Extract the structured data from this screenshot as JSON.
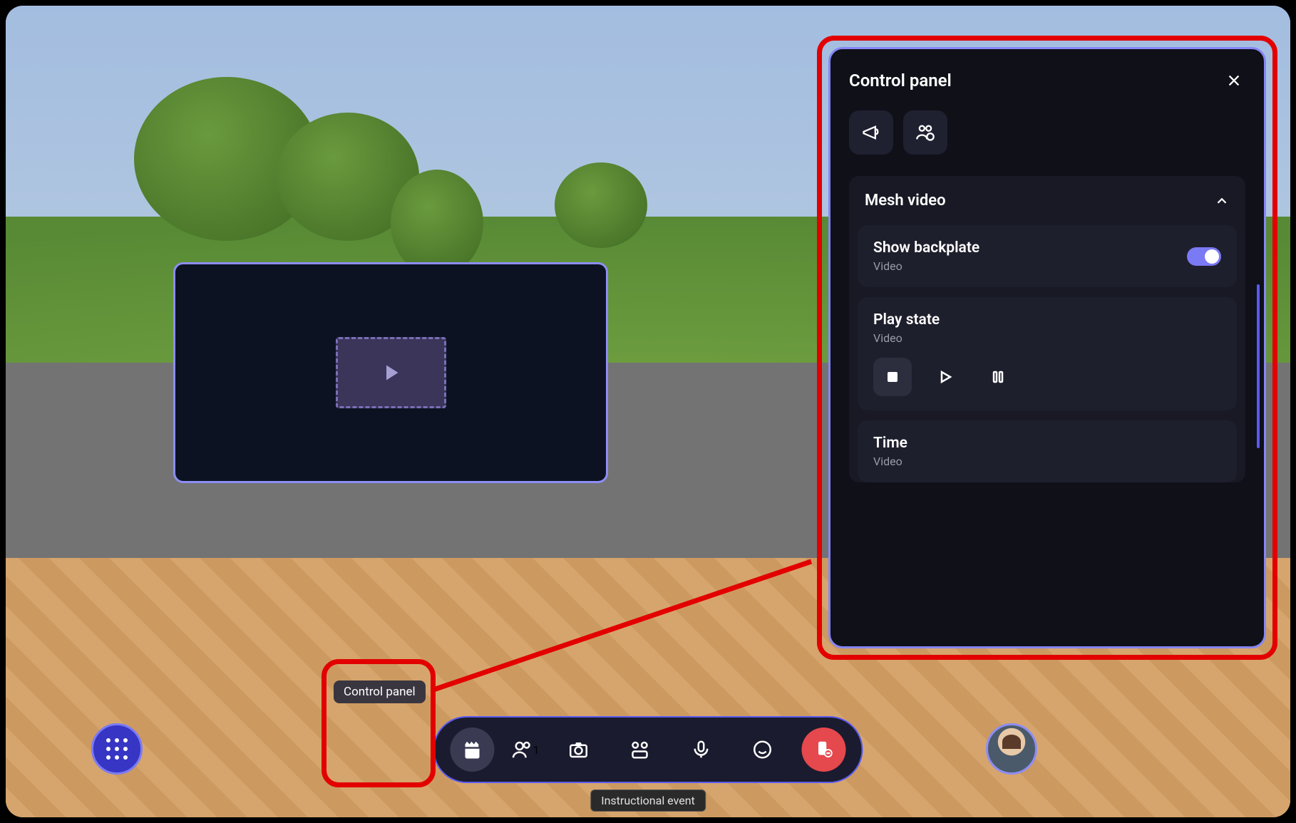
{
  "tooltip": "Control panel",
  "bottom_label": "Instructional event",
  "toolbar": {
    "participant_count": "1"
  },
  "panel": {
    "title": "Control panel",
    "section_title": "Mesh video",
    "backplate": {
      "title": "Show backplate",
      "sub": "Video"
    },
    "playstate": {
      "title": "Play state",
      "sub": "Video"
    },
    "time": {
      "title": "Time",
      "sub": "Video"
    }
  }
}
